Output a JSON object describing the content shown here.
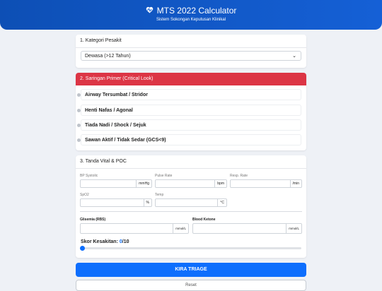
{
  "header": {
    "title": "MTS 2022 Calculator",
    "subtitle": "Sistem Sokongan Keputusan Klinikal",
    "icon": "heart-pulse-icon"
  },
  "section1": {
    "title": "1. Kategori Pesakit",
    "selected": "Dewasa (>12 Tahun)"
  },
  "section2": {
    "title": "2. Saringan Primer (Critical Look)",
    "accent": "#dc3545",
    "items": [
      "Airway Tersumbat / Stridor",
      "Henti Nafas / Agonal",
      "Tiada Nadi / Shock / Sejuk",
      "Sawan Aktif / Tidak Sedar (GCS<9)"
    ]
  },
  "section3": {
    "title": "3. Tanda Vital & POC",
    "bp_label": "BP Systolic",
    "bp_unit": "mmHg",
    "pulse_label": "Pulse Rate",
    "pulse_unit": "bpm",
    "resp_label": "Resp. Rate",
    "resp_unit": "/min",
    "spo2_label": "SpO2",
    "spo2_unit": "%",
    "temp_label": "Temp",
    "temp_unit": "°C",
    "glu_label": "Glisemia (RBS)",
    "glu_unit": "mmol/L",
    "ket_label": "Blood Ketone",
    "ket_unit": "mmol/L",
    "score_label": "Skor Kesakitan:",
    "score_value": "0",
    "score_max": "/10",
    "slider_fraction": 0
  },
  "actions": {
    "submit": "KIRA TRIAGE",
    "reset": "Reset"
  },
  "colors": {
    "primary": "#0d6efd",
    "header": "#1560d6"
  }
}
